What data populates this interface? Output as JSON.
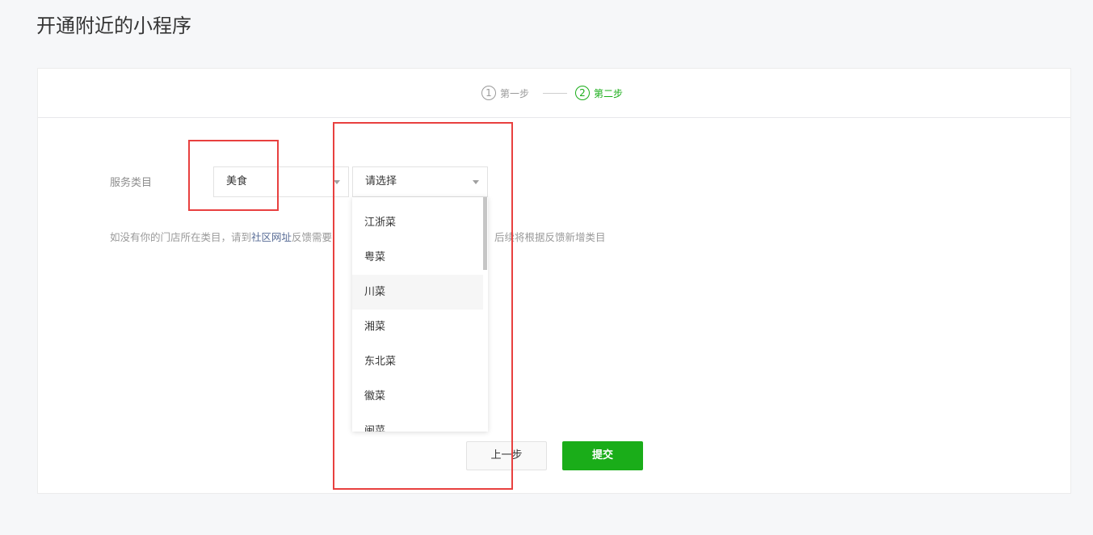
{
  "page": {
    "title": "开通附近的小程序"
  },
  "steps": [
    {
      "num": "1",
      "label": "第一步",
      "active": false
    },
    {
      "num": "2",
      "label": "第二步",
      "active": true
    }
  ],
  "form": {
    "label": "服务类目",
    "primary_select": {
      "value": "美食"
    },
    "secondary_select": {
      "placeholder": "请选择"
    },
    "hint": {
      "prefix": "如没有你的门店所在类目，请到",
      "link": "社区网址",
      "middle": "反馈需要",
      "suffix": "后续将根据反馈新增类目"
    }
  },
  "dropdown": {
    "options": [
      "江浙菜",
      "粤菜",
      "川菜",
      "湘菜",
      "东北菜",
      "徽菜",
      "闽菜"
    ],
    "hovered": "川菜"
  },
  "buttons": {
    "prev": "上一步",
    "submit": "提交"
  },
  "colors": {
    "accent": "#1aad19",
    "link": "#576b95",
    "annotation": "#e8403f"
  }
}
